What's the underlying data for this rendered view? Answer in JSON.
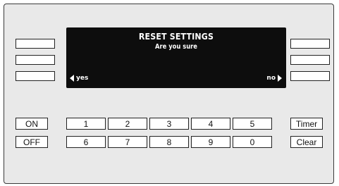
{
  "display": {
    "title": "RESET SETTINGS",
    "subtitle": "Are you sure",
    "softkey_left": "yes",
    "softkey_right": "no",
    "softkey_left_icon": "triangle-left-icon",
    "softkey_right_icon": "triangle-right-icon"
  },
  "keypad": {
    "on_label": "ON",
    "off_label": "OFF",
    "timer_label": "Timer",
    "clear_label": "Clear",
    "digits_row1": [
      "1",
      "2",
      "3",
      "4",
      "5"
    ],
    "digits_row2": [
      "6",
      "7",
      "8",
      "9",
      "0"
    ]
  },
  "colors": {
    "panel": "#e9e9e9",
    "display": "#0d0d0d",
    "display_text": "#ffffff"
  }
}
